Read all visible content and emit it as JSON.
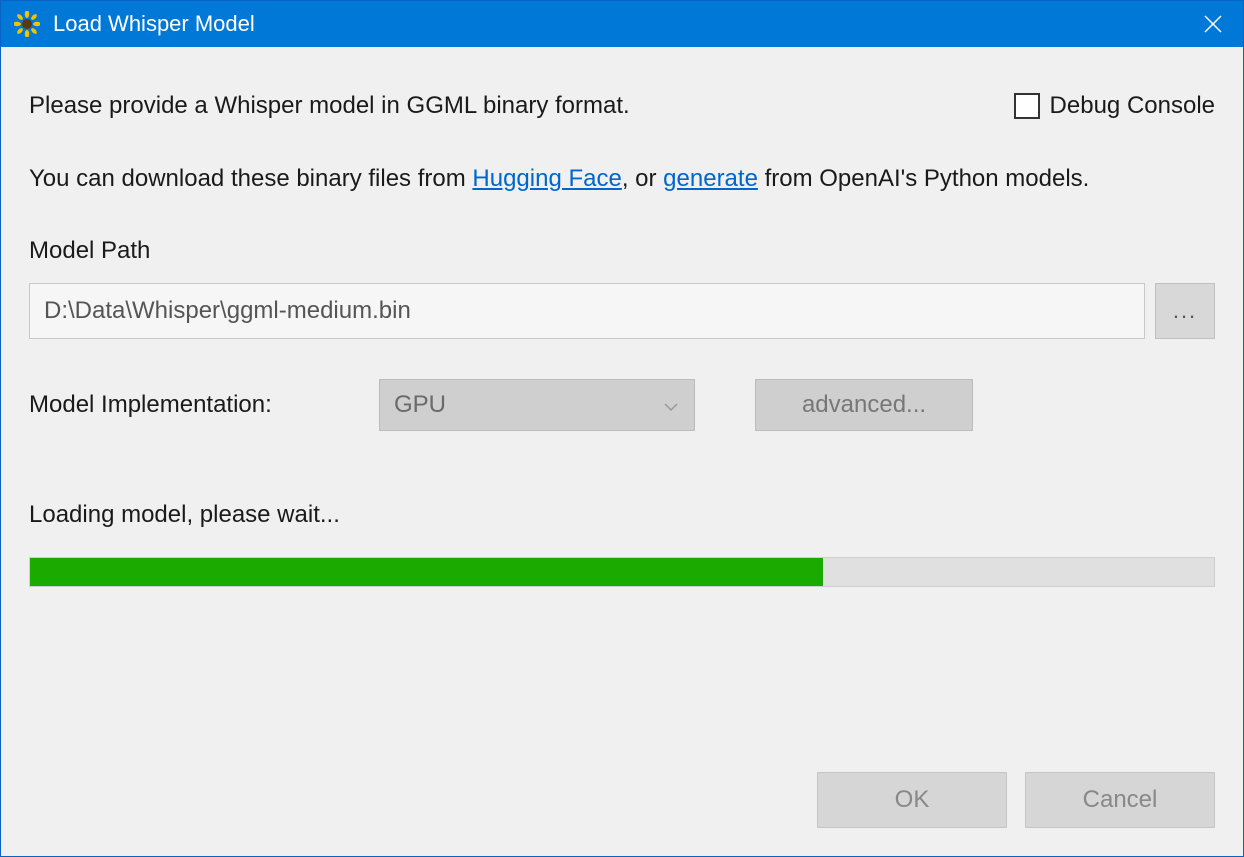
{
  "titlebar": {
    "title": "Load Whisper Model"
  },
  "content": {
    "prompt": "Please provide a Whisper model in GGML binary format.",
    "debug_label": "Debug Console",
    "help_prefix": "You can download these binary files from ",
    "help_link1": "Hugging Face",
    "help_mid": ", or ",
    "help_link2": "generate",
    "help_suffix": " from OpenAI's Python models.",
    "model_path_label": "Model Path",
    "model_path_value": "D:\\Data\\Whisper\\ggml-medium.bin",
    "browse_label": "...",
    "impl_label": "Model Implementation:",
    "impl_value": "GPU",
    "advanced_label": "advanced...",
    "status": "Loading model, please wait...",
    "progress_percent": 67,
    "ok_label": "OK",
    "cancel_label": "Cancel"
  }
}
